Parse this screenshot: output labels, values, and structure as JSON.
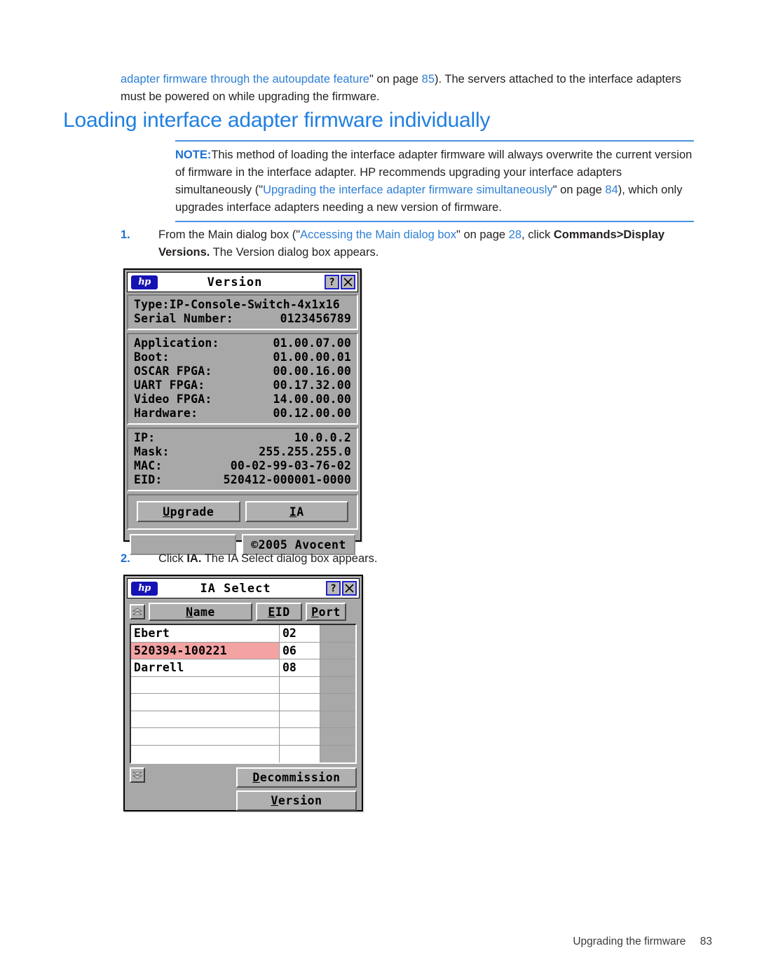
{
  "document": {
    "intro_pre": "adapter firmware through the autoupdate feature",
    "intro_mid": "\" on page ",
    "intro_page": "85",
    "intro_post": "). The servers attached to the interface adapters must be powered on while upgrading the firmware.",
    "title": "Loading interface adapter firmware individually",
    "note": {
      "label": "NOTE:",
      "text_1": "This method of loading the interface adapter firmware will always overwrite the current version of firmware in the interface adapter. HP recommends upgrading your interface adapters simultaneously (\"",
      "link": "Upgrading the interface adapter firmware simultaneously",
      "text_2": "\" on page ",
      "page": "84",
      "text_3": "), which only upgrades interface adapters needing a new version of firmware."
    },
    "steps": [
      {
        "number": "1.",
        "text_1": "From the Main dialog box (\"",
        "link": "Accessing the Main dialog box",
        "text_2": "\" on page ",
        "page": "28",
        "text_3": ", click ",
        "bold": "Commands>Display Versions.",
        "text_4": " The Version dialog box appears."
      },
      {
        "number": "2.",
        "text_1": "Click ",
        "bold": "IA.",
        "text_2": " The IA Select dialog box appears."
      }
    ],
    "footer": {
      "section": "Upgrading the firmware",
      "page_number": "83"
    },
    "colors": {
      "link": "#2e7fd4",
      "heading": "#1f7fe0",
      "rule": "#4a90e2",
      "selection": "#f4a3a3",
      "hp_blue": "#1613b5"
    }
  },
  "version_dialog": {
    "logo_text": "hp",
    "title": "Version",
    "help_button": "?",
    "close_button": "✕",
    "identity": [
      {
        "label": "Type:IP-Console-Switch-4x1x16",
        "value": ""
      },
      {
        "label": "Serial Number:",
        "value": "0123456789"
      }
    ],
    "firmware": [
      {
        "label": "Application:",
        "value": "01.00.07.00"
      },
      {
        "label": "Boot:",
        "value": "01.00.00.01"
      },
      {
        "label": "OSCAR FPGA:",
        "value": "00.00.16.00"
      },
      {
        "label": "UART FPGA:",
        "value": "00.17.32.00"
      },
      {
        "label": "Video FPGA:",
        "value": "14.00.00.00"
      },
      {
        "label": "Hardware:",
        "value": "00.12.00.00"
      }
    ],
    "network": [
      {
        "label": "IP:",
        "value": "10.0.0.2"
      },
      {
        "label": "Mask:",
        "value": "255.255.255.0"
      },
      {
        "label": "MAC:",
        "value": "00-02-99-03-76-02"
      },
      {
        "label": "EID:",
        "value": "520412-000001-0000"
      }
    ],
    "buttons": {
      "upgrade_accel": "U",
      "upgrade_rest": "pgrade",
      "ia_accel": "I",
      "ia_rest": "A"
    },
    "copyright": "©2005 Avocent"
  },
  "ia_select_dialog": {
    "logo_text": "hp",
    "title": "IA Select",
    "help_button": "?",
    "close_button": "✕",
    "columns": [
      {
        "accel": "N",
        "rest": "ame"
      },
      {
        "accel": "E",
        "rest": "ID"
      },
      {
        "accel": "P",
        "rest": "ort"
      }
    ],
    "rows": [
      {
        "name": "Ebert",
        "eid": "02",
        "selected": false
      },
      {
        "name": "520394-100221",
        "eid": "06",
        "selected": true
      },
      {
        "name": "Darrell",
        "eid": "08",
        "selected": false
      },
      {
        "name": "",
        "eid": "",
        "selected": false
      },
      {
        "name": "",
        "eid": "",
        "selected": false
      },
      {
        "name": "",
        "eid": "",
        "selected": false
      },
      {
        "name": "",
        "eid": "",
        "selected": false
      },
      {
        "name": "",
        "eid": "",
        "selected": false
      }
    ],
    "buttons": {
      "decommission_accel": "D",
      "decommission_rest": "ecommission",
      "version_accel": "V",
      "version_rest": "ersion"
    }
  }
}
